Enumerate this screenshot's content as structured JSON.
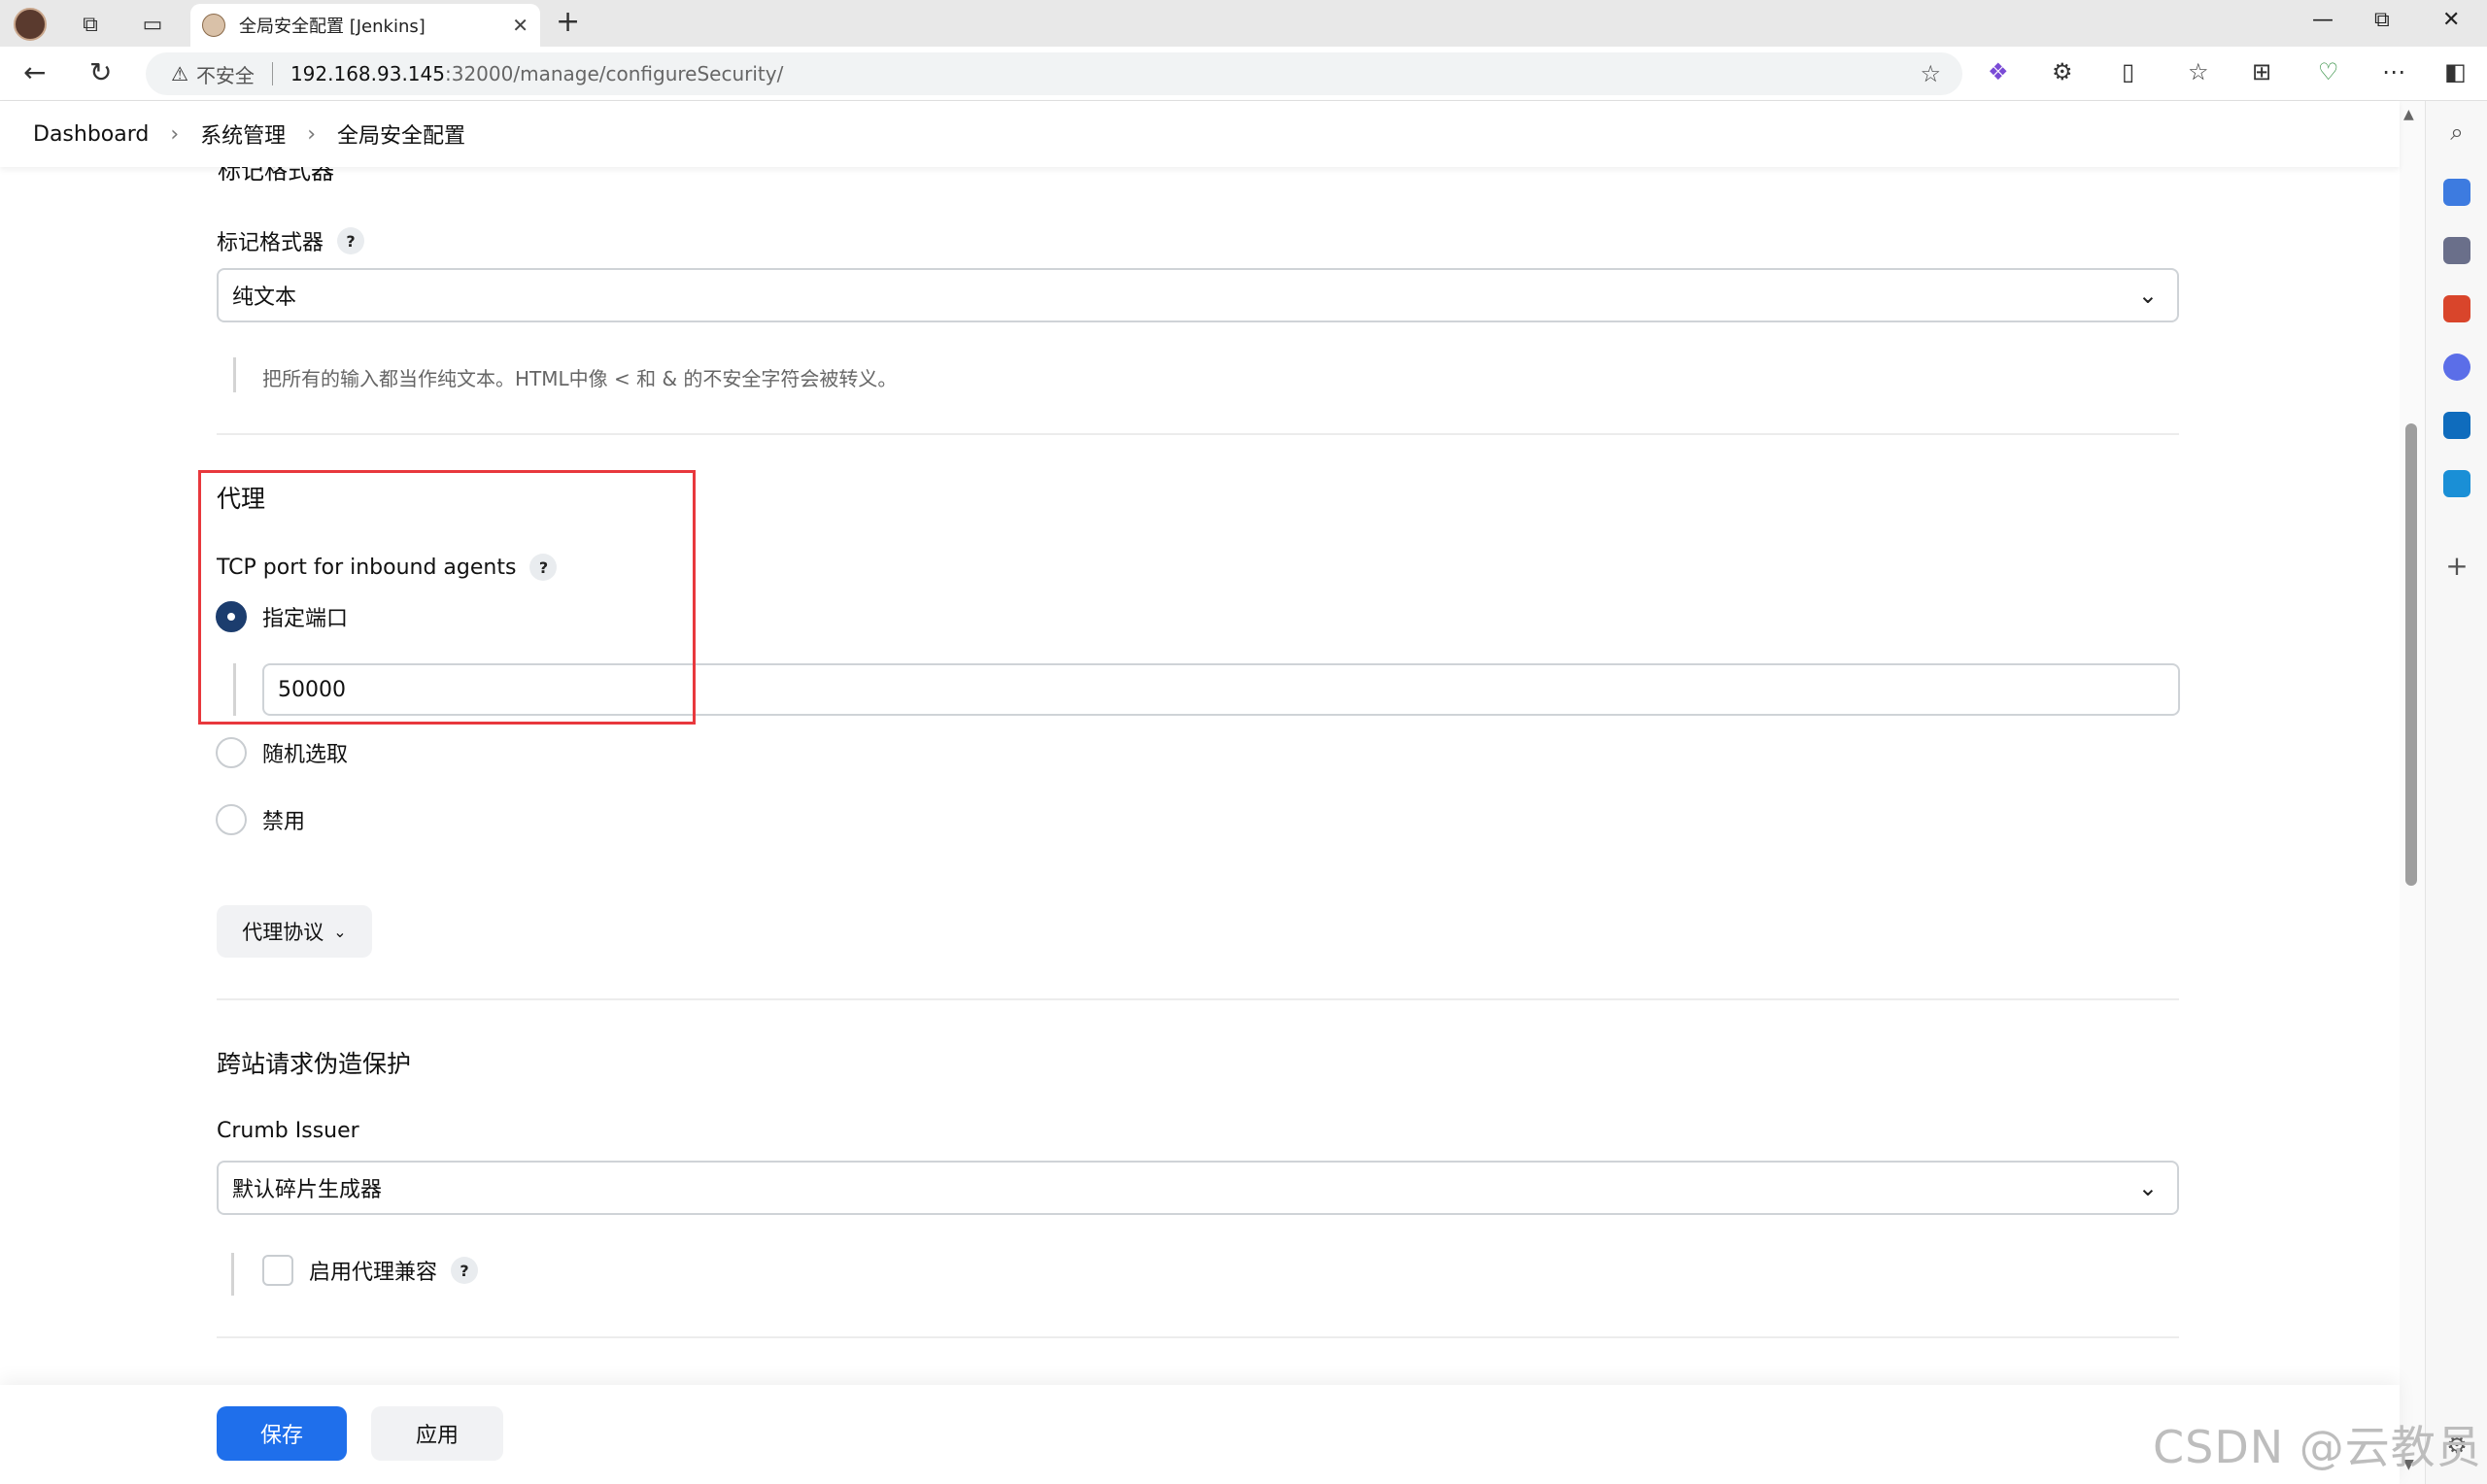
{
  "browser": {
    "tab_title": "全局安全配置 [Jenkins]",
    "not_secure_label": "不安全",
    "url_host": "192.168.93.145",
    "url_path": ":32000/manage/configureSecurity/"
  },
  "breadcrumb": {
    "items": [
      "Dashboard",
      "系统管理",
      "全局安全配置"
    ]
  },
  "markup_formatter": {
    "partial_section_title": "标记格式器",
    "label": "标记格式器",
    "help": "?",
    "selected": "纯文本",
    "description": "把所有的输入都当作纯文本。HTML中像 < 和 & 的不安全字符会被转义。"
  },
  "agents": {
    "title": "代理",
    "tcp_label": "TCP port for inbound agents",
    "help": "?",
    "options": [
      "指定端口",
      "随机选取",
      "禁用"
    ],
    "port_value": "50000",
    "protocols_button": "代理协议"
  },
  "csrf": {
    "title": "跨站请求伪造保护",
    "issuer_label": "Crumb Issuer",
    "issuer_selected": "默认碎片生成器",
    "proxy_compat_label": "启用代理兼容",
    "help": "?"
  },
  "actions": {
    "save": "保存",
    "apply": "应用"
  },
  "watermark": "CSDN @云教员",
  "colors": {
    "primary_button": "#1f6feb",
    "radio_checked": "#1c3d6e",
    "annotation_box": "#e8383d"
  }
}
